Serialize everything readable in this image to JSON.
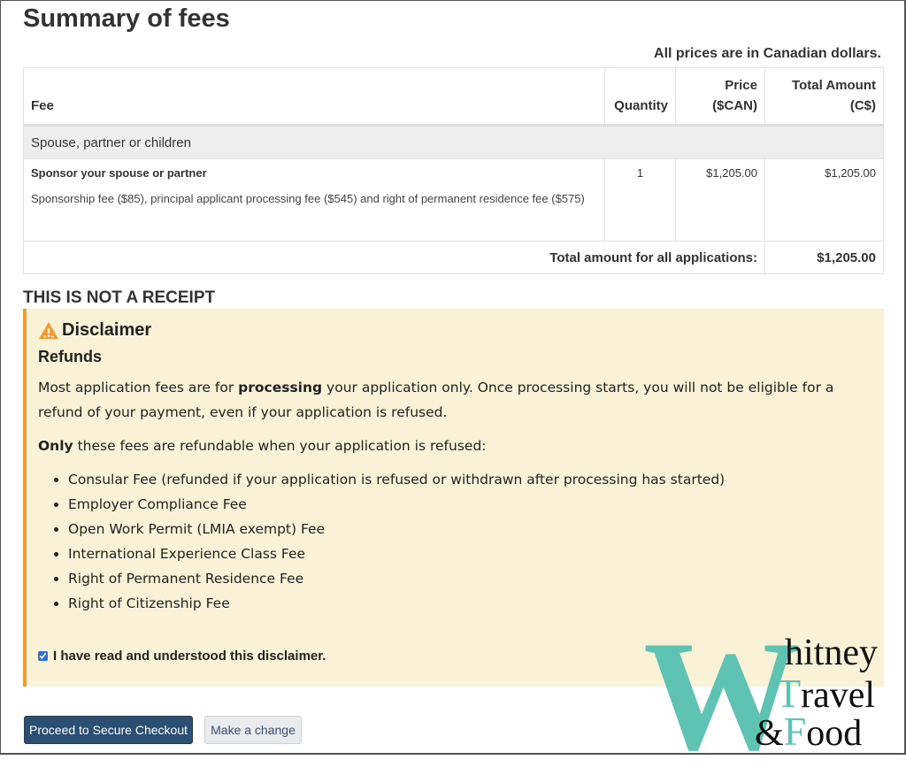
{
  "page": {
    "title": "Summary of fees",
    "currency_note": "All prices are in Canadian dollars."
  },
  "fees_table": {
    "headers": {
      "fee": "Fee",
      "quantity": "Quantity",
      "price_line1": "Price",
      "price_line2": "($CAN)",
      "total_line1": "Total Amount",
      "total_line2": "(C$)"
    },
    "groups": [
      {
        "label": "Spouse, partner or children",
        "items": [
          {
            "title": "Sponsor your spouse or partner",
            "description": "Sponsorship fee ($85), principal applicant processing fee ($545) and right of permanent residence fee ($575)",
            "quantity": "1",
            "price": "$1,205.00",
            "total": "$1,205.00"
          }
        ]
      }
    ],
    "total_label": "Total amount for all applications:",
    "total_value": "$1,205.00"
  },
  "receipt_notice": "THIS IS NOT A RECEIPT",
  "disclaimer": {
    "icon": "warning-triangle-icon",
    "title": "Disclaimer",
    "subtitle": "Refunds",
    "para1_before": "Most application fees are for ",
    "para1_bold": "processing",
    "para1_after": " your application only. Once processing starts, you will not be eligible for a refund of your payment, even if your application is refused.",
    "para2_bold": "Only",
    "para2_after": " these fees are refundable when your application is refused:",
    "refundable_fees": [
      "Consular Fee (refunded if your application is refused or withdrawn after processing has started)",
      "Employer Compliance Fee",
      "Open Work Permit (LMIA exempt) Fee",
      "International Experience Class Fee",
      "Right of Permanent Residence Fee",
      "Right of Citizenship Fee"
    ],
    "acknowledge_label": "I have read and understood this disclaimer.",
    "acknowledge_checked": true
  },
  "actions": {
    "proceed_label": "Proceed to Secure Checkout",
    "change_label": "Make a change"
  },
  "watermark": {
    "big_letter": "W",
    "line1": "hitney",
    "line2_initial": "T",
    "line2_rest": "ravel",
    "line3_amp": "&",
    "line3_initial": "F",
    "line3_rest": "ood"
  },
  "colors": {
    "primary_button": "#2b4f73",
    "disclaimer_bg": "#faf2d7",
    "disclaimer_accent": "#f29a2e",
    "logo_teal": "#5fc3b3"
  }
}
